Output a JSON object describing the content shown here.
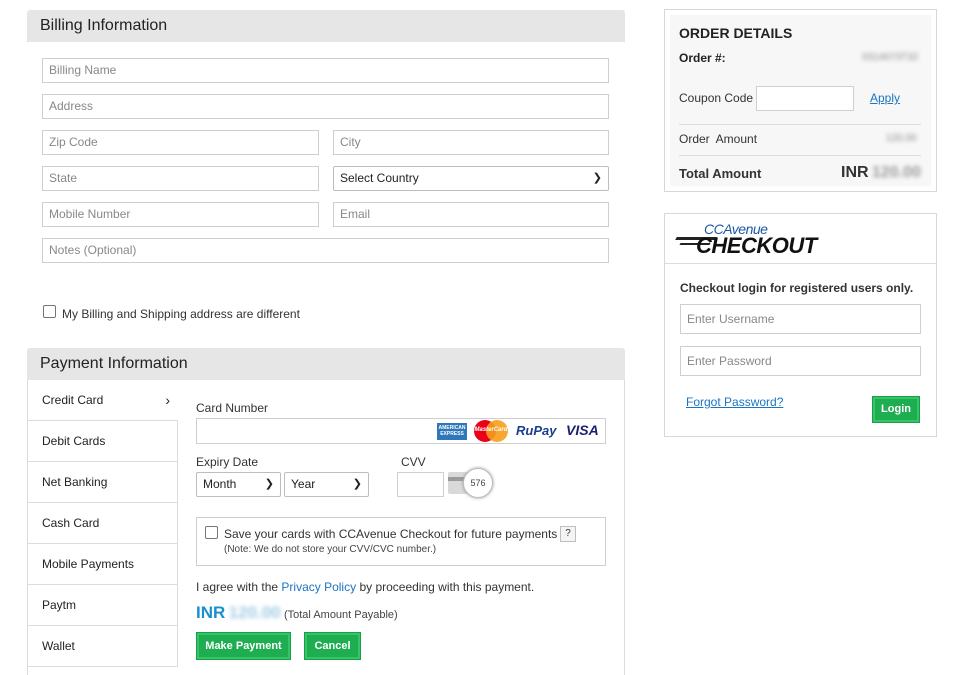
{
  "billing": {
    "header": "Billing Information",
    "fields": {
      "billing_name": "Billing Name",
      "address": "Address",
      "zip": "Zip Code",
      "city": "City",
      "state": "State",
      "country": "Select Country",
      "mobile": "Mobile Number",
      "email": "Email",
      "notes": "Notes (Optional)"
    },
    "different_address_label": "My Billing and Shipping address are different"
  },
  "payment": {
    "header": "Payment Information",
    "tabs": [
      "Credit Card",
      "Debit Cards",
      "Net Banking",
      "Cash Card",
      "Mobile Payments",
      "Paytm",
      "Wallet"
    ],
    "card_number_label": "Card Number",
    "card_brands": [
      "AMERICAN EXPRESS",
      "MasterCard",
      "RuPay",
      "VISA"
    ],
    "expiry_label": "Expiry Date",
    "month_value": "Month",
    "year_value": "Year",
    "cvv_label": "CVV",
    "cvv_hint": "576",
    "save_card_label": "Save your cards with CCAvenue Checkout for future payments",
    "save_card_help": "?",
    "save_card_note": "(Note: We do not store your CVV/CVC number.)",
    "agree_prefix": "I agree with the",
    "privacy_link": "Privacy Policy",
    "agree_suffix": "by proceeding with this payment.",
    "currency": "INR",
    "amount": "120.00",
    "payable_note": "(Total Amount Payable)",
    "make_payment": "Make Payment",
    "cancel": "Cancel"
  },
  "order": {
    "title": "ORDER DETAILS",
    "order_label": "Order #:",
    "order_value": "0314673T32",
    "coupon_label": "Coupon Code",
    "apply": "Apply",
    "order_amount_label": "Order  Amount",
    "order_amount_value": "120.00",
    "total_label": "Total Amount",
    "total_currency": "INR",
    "total_value": "120.00"
  },
  "checkout": {
    "logo_top": "CCAvenue",
    "logo_bottom": "CHECKOUT",
    "login_note": "Checkout login for registered users only.",
    "username_placeholder": "Enter Username",
    "password_placeholder": "Enter Password",
    "forgot": "Forgot Password?",
    "login": "Login"
  },
  "colors": {
    "green_button": "#1fad52",
    "link_blue": "#1a75c2",
    "amount_blue": "#1a8fcf"
  }
}
